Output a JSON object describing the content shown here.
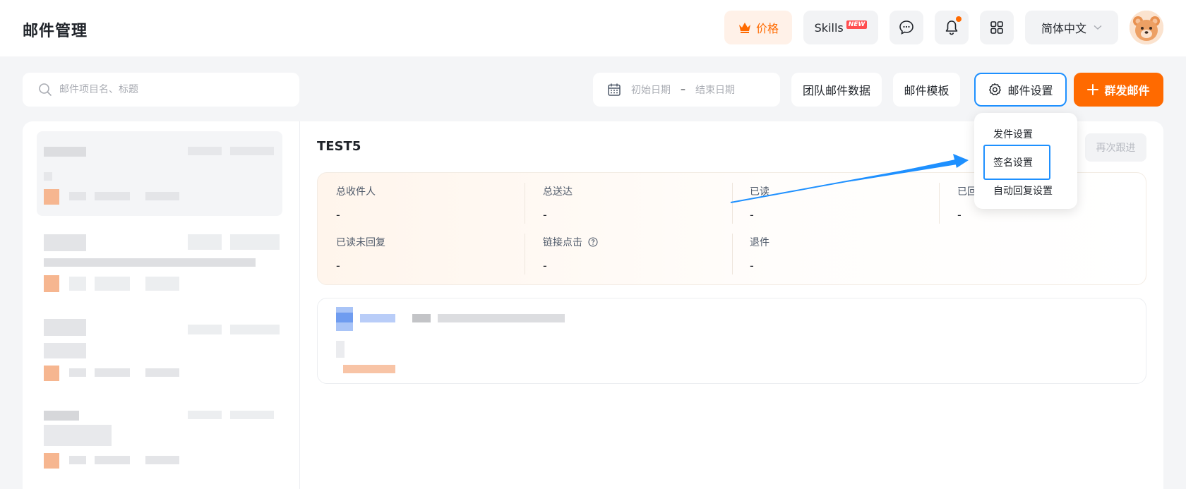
{
  "header": {
    "title": "邮件管理",
    "price_label": "价格",
    "skills_label": "Skills",
    "skills_badge": "NEW",
    "language_label": "简体中文"
  },
  "toolbar": {
    "search_placeholder": "邮件项目名、标题",
    "start_date_placeholder": "初始日期",
    "date_separator": "–",
    "end_date_placeholder": "结束日期",
    "team_data_label": "团队邮件数据",
    "template_label": "邮件模板",
    "settings_label": "邮件设置",
    "mass_send_label": "群发邮件"
  },
  "detail": {
    "title": "TEST5",
    "followup_label": "再次跟进",
    "stats": [
      {
        "label": "总收件人",
        "value": "-"
      },
      {
        "label": "总送达",
        "value": "-"
      },
      {
        "label": "已读",
        "value": "-"
      },
      {
        "label": "已回",
        "value": "-"
      },
      {
        "label": "已读未回复",
        "value": "-"
      },
      {
        "label": "链接点击",
        "value": "-"
      },
      {
        "label": "退件",
        "value": "-"
      }
    ]
  },
  "settings_menu": {
    "items": [
      "发件设置",
      "签名设置",
      "自动回复设置"
    ],
    "highlighted_index": 1
  },
  "colors": {
    "brand_orange": "#ff6a00",
    "highlight_blue": "#1e90ff"
  }
}
